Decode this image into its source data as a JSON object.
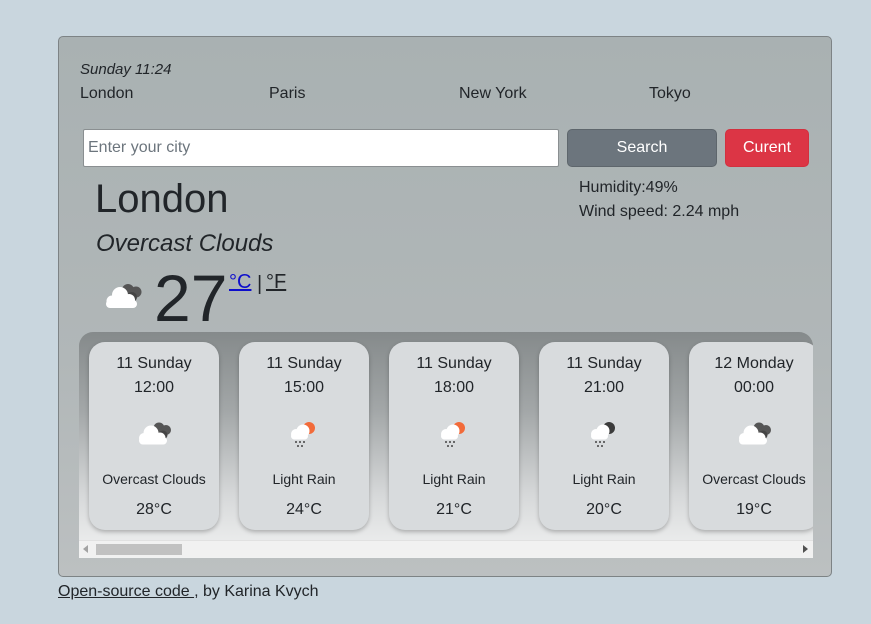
{
  "header": {
    "date": "Sunday 11:24",
    "cities": [
      "London",
      "Paris",
      "New York",
      "Tokyo"
    ]
  },
  "search": {
    "placeholder": "Enter your city",
    "value": "",
    "search_label": "Search",
    "current_label": "Curent"
  },
  "current": {
    "city": "London",
    "description": "Overcast Clouds",
    "humidity": "Humidity:49%",
    "wind": "Wind speed: 2.24 mph",
    "temperature": "27",
    "unit_c": "°C",
    "unit_sep": "|",
    "unit_f": "°F",
    "icon": "overcast-clouds-icon"
  },
  "forecast": [
    {
      "day": "11 Sunday",
      "time": "12:00",
      "description": "Overcast Clouds",
      "temp": "28°C",
      "icon": "overcast-clouds-icon"
    },
    {
      "day": "11 Sunday",
      "time": "15:00",
      "description": "Light Rain",
      "temp": "24°C",
      "icon": "light-rain-day-icon"
    },
    {
      "day": "11 Sunday",
      "time": "18:00",
      "description": "Light Rain",
      "temp": "21°C",
      "icon": "light-rain-day-icon"
    },
    {
      "day": "11 Sunday",
      "time": "21:00",
      "description": "Light Rain",
      "temp": "20°C",
      "icon": "light-rain-night-icon"
    },
    {
      "day": "12 Monday",
      "time": "00:00",
      "description": "Overcast Clouds",
      "temp": "19°C",
      "icon": "overcast-clouds-icon"
    }
  ],
  "footer": {
    "link_text": "Open-source code ",
    "by_text": ", by Karina Kvych"
  },
  "colors": {
    "page_bg": "#c9d6de",
    "search_button": "#6c757d",
    "current_button": "#dc3545",
    "link_blue": "#0d0dcc"
  }
}
